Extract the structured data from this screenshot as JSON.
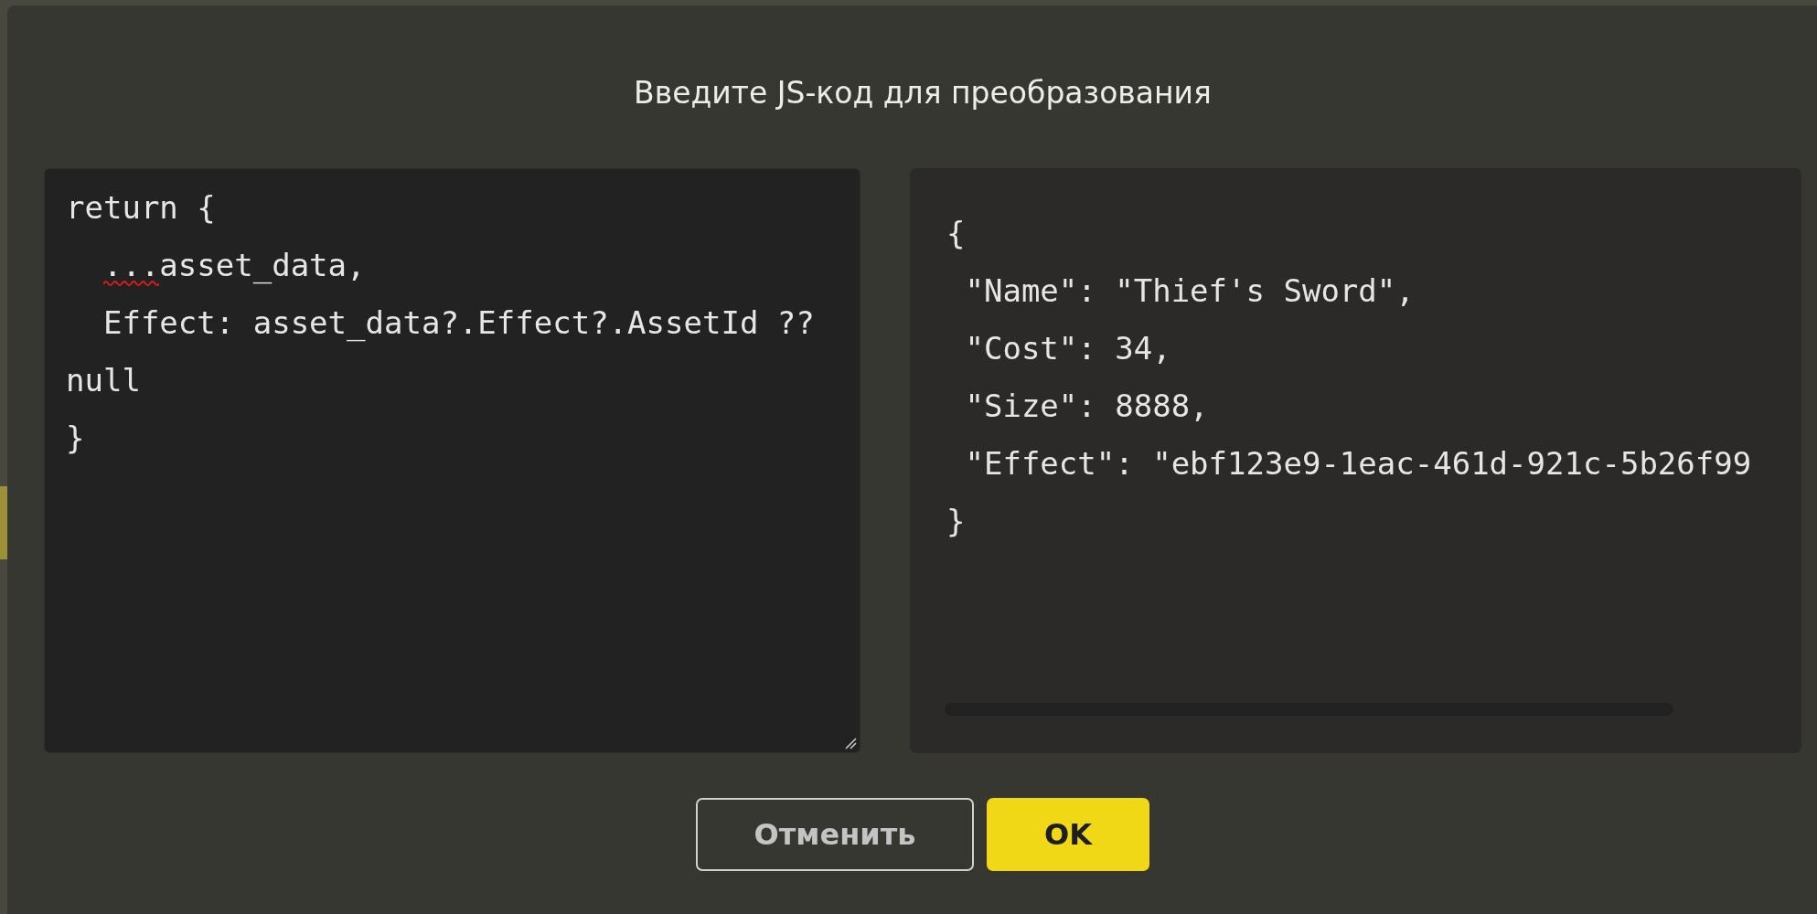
{
  "dialog": {
    "title": "Введите JS-код для преобразования"
  },
  "code_editor": {
    "lines": [
      {
        "parts": [
          {
            "text": "return {",
            "misspelled": false
          }
        ]
      },
      {
        "parts": [
          {
            "text": "  ...",
            "misspelled": true
          },
          {
            "text": "asset_data,",
            "misspelled": false
          }
        ]
      },
      {
        "parts": [
          {
            "text": "  Effect: asset_data?.Effect?.AssetId ??",
            "misspelled": false
          }
        ]
      },
      {
        "parts": [
          {
            "text": "null",
            "misspelled": false
          }
        ]
      },
      {
        "parts": [
          {
            "text": "}",
            "misspelled": false
          }
        ]
      }
    ]
  },
  "preview": {
    "lines": [
      "{",
      " \"Name\": \"Thief's Sword\",",
      " \"Cost\": 34,",
      " \"Size\": 8888,",
      " \"Effect\": \"ebf123e9-1eac-461d-921c-5b26f99",
      "}"
    ]
  },
  "buttons": [
    {
      "label": "Отменить",
      "kind": "secondary"
    },
    {
      "label": "OK",
      "kind": "primary"
    }
  ]
}
